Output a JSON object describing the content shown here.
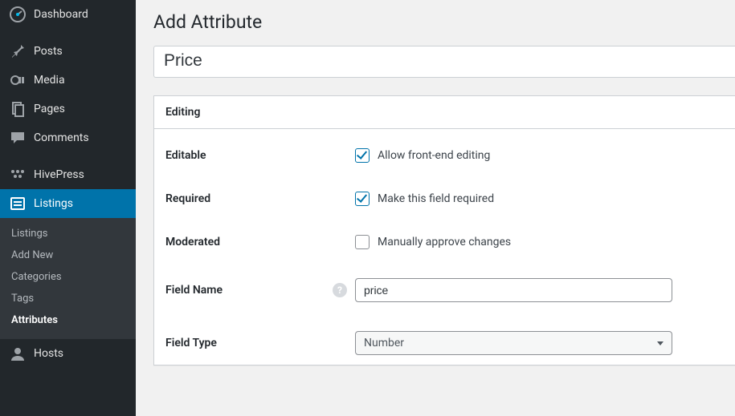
{
  "sidebar": {
    "items": [
      {
        "label": "Dashboard",
        "icon": "dashboard"
      },
      {
        "label": "Posts",
        "icon": "pin"
      },
      {
        "label": "Media",
        "icon": "media"
      },
      {
        "label": "Pages",
        "icon": "pages"
      },
      {
        "label": "Comments",
        "icon": "comment"
      },
      {
        "label": "HivePress",
        "icon": "hivepress"
      },
      {
        "label": "Listings",
        "icon": "listings"
      },
      {
        "label": "Hosts",
        "icon": "user"
      }
    ],
    "submenu": [
      {
        "label": "Listings"
      },
      {
        "label": "Add New"
      },
      {
        "label": "Categories"
      },
      {
        "label": "Tags"
      },
      {
        "label": "Attributes"
      }
    ]
  },
  "page": {
    "title": "Add Attribute",
    "title_input": "Price"
  },
  "panel": {
    "header": "Editing",
    "rows": {
      "editable": {
        "label": "Editable",
        "check_label": "Allow front-end editing",
        "checked": true
      },
      "required": {
        "label": "Required",
        "check_label": "Make this field required",
        "checked": true
      },
      "moderated": {
        "label": "Moderated",
        "check_label": "Manually approve changes",
        "checked": false
      },
      "field_name": {
        "label": "Field Name",
        "value": "price"
      },
      "field_type": {
        "label": "Field Type",
        "value": "Number"
      }
    }
  }
}
